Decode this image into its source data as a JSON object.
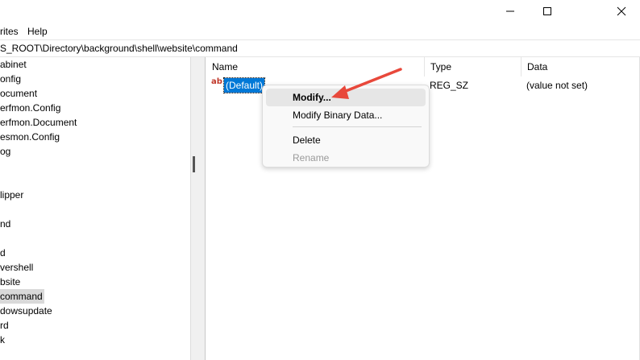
{
  "window": {
    "minimize_icon": "minimize-icon",
    "maximize_icon": "maximize-icon",
    "close_icon": "close-icon"
  },
  "menubar": {
    "items": [
      "rites",
      "Help"
    ]
  },
  "address": {
    "path": "S_ROOT\\Directory\\background\\shell\\website\\command"
  },
  "tree": {
    "items": [
      "abinet",
      "onfig",
      "ocument",
      "erfmon.Config",
      "erfmon.Document",
      "esmon.Config",
      "og",
      "",
      "lipper",
      "",
      "nd",
      "",
      "d",
      "vershell",
      "bsite",
      "command",
      "dowsupdate",
      "rd",
      "k"
    ],
    "selected": "command"
  },
  "list": {
    "columns": [
      "Name",
      "Type",
      "Data"
    ],
    "rows": [
      {
        "name": "(Default)",
        "type": "REG_SZ",
        "data": "(value not set)",
        "icon": "string-value-icon"
      }
    ]
  },
  "context_menu": {
    "items": [
      "Modify...",
      "Modify Binary Data...",
      "Delete",
      "Rename"
    ],
    "hovered": "Modify...",
    "disabled": [
      "Rename"
    ]
  },
  "colors": {
    "selection": "#0078d7",
    "arrow": "#e8483b",
    "tree_selected": "#d9d9d9"
  }
}
